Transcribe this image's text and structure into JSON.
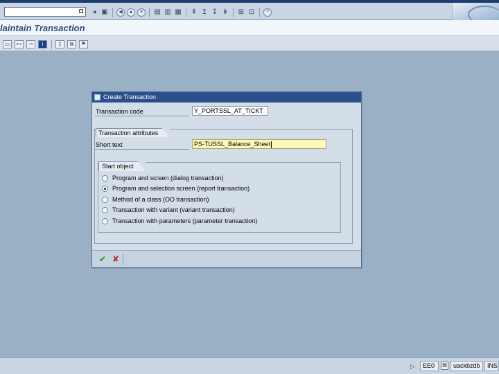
{
  "window": {
    "title": "laintain Transaction"
  },
  "dialog": {
    "title": "Create Transaction",
    "transaction_code_label": "Transaction code",
    "transaction_code_value": "Y_PORTSSL_AT_TICKT",
    "attributes_tab": "Transaction attributes",
    "short_text_label": "Short text",
    "short_text_value": "PS-TUSSL_Balance_Sheet",
    "start_object_tab": "Start object",
    "options": [
      {
        "label": "Program and screen (dialog transaction)",
        "selected": false
      },
      {
        "label": "Program and selection screen (report transaction)",
        "selected": true
      },
      {
        "label": "Method of a class (OO transaction)",
        "selected": false
      },
      {
        "label": "Transaction with variant (variant transaction)",
        "selected": false
      },
      {
        "label": "Transaction with parameters (parameter transaction)",
        "selected": false
      }
    ]
  },
  "statusbar": {
    "system": "EE0",
    "host": "uackbzdb",
    "mode": "INS"
  },
  "colors": {
    "background": "#9ab0c4",
    "title_text": "#2e4c80",
    "dialog_title": "#2b4f8a",
    "short_text_field": "#fff7b8",
    "ok_icon": "#1a8a1a",
    "cancel_icon": "#c81a1a"
  }
}
